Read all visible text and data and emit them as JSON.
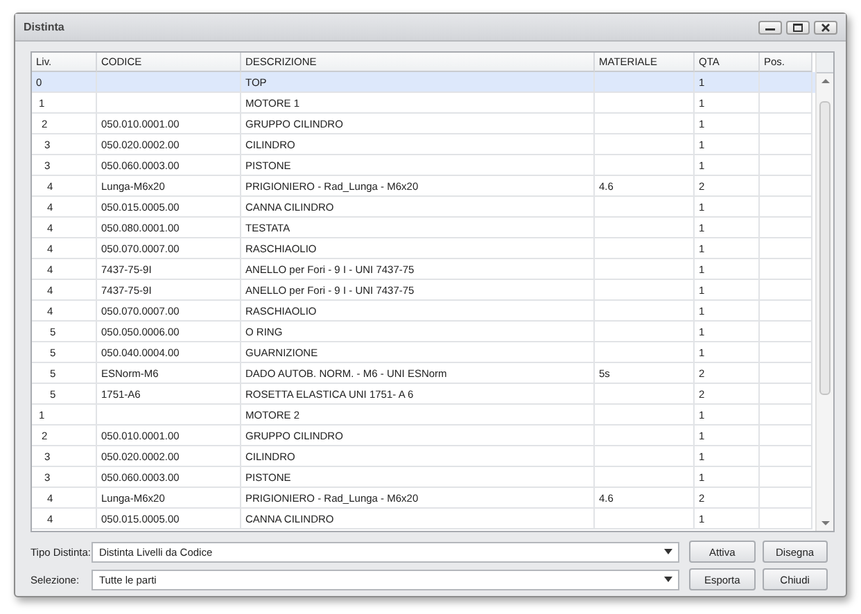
{
  "window": {
    "title": "Distinta"
  },
  "table": {
    "columns": [
      "Liv.",
      "CODICE",
      "DESCRIZIONE",
      "MATERIALE",
      "QTA",
      "Pos."
    ],
    "rows": [
      {
        "cells": [
          "0",
          "",
          "TOP",
          "",
          "1",
          ""
        ],
        "selected": true
      },
      {
        "cells": [
          "1",
          "",
          "MOTORE 1",
          "",
          "1",
          ""
        ],
        "selected": false
      },
      {
        "cells": [
          "2",
          "050.010.0001.00",
          "GRUPPO CILINDRO",
          "",
          "1",
          ""
        ],
        "selected": false
      },
      {
        "cells": [
          "3",
          "050.020.0002.00",
          "CILINDRO",
          "",
          "1",
          ""
        ],
        "selected": false
      },
      {
        "cells": [
          "3",
          "050.060.0003.00",
          "PISTONE",
          "",
          "1",
          ""
        ],
        "selected": false
      },
      {
        "cells": [
          "4",
          "Lunga-M6x20",
          "PRIGIONIERO - Rad_Lunga - M6x20",
          "4.6",
          "2",
          ""
        ],
        "selected": false
      },
      {
        "cells": [
          "4",
          "050.015.0005.00",
          "CANNA CILINDRO",
          "",
          "1",
          ""
        ],
        "selected": false
      },
      {
        "cells": [
          "4",
          "050.080.0001.00",
          "TESTATA",
          "",
          "1",
          ""
        ],
        "selected": false
      },
      {
        "cells": [
          "4",
          "050.070.0007.00",
          "RASCHIAOLIO",
          "",
          "1",
          ""
        ],
        "selected": false
      },
      {
        "cells": [
          "4",
          "7437-75-9I",
          "ANELLO per Fori - 9 I - UNI 7437-75",
          "",
          "1",
          ""
        ],
        "selected": false
      },
      {
        "cells": [
          "4",
          "7437-75-9I",
          "ANELLO per Fori - 9 I - UNI 7437-75",
          "",
          "1",
          ""
        ],
        "selected": false
      },
      {
        "cells": [
          "4",
          "050.070.0007.00",
          "RASCHIAOLIO",
          "",
          "1",
          ""
        ],
        "selected": false
      },
      {
        "cells": [
          "5",
          "050.050.0006.00",
          "O RING",
          "",
          "1",
          ""
        ],
        "selected": false
      },
      {
        "cells": [
          "5",
          "050.040.0004.00",
          "GUARNIZIONE",
          "",
          "1",
          ""
        ],
        "selected": false
      },
      {
        "cells": [
          "5",
          "ESNorm-M6",
          "DADO AUTOB. NORM. - M6 - UNI ESNorm",
          "5s",
          "2",
          ""
        ],
        "selected": false
      },
      {
        "cells": [
          "5",
          "1751-A6",
          "ROSETTA ELASTICA UNI 1751- A 6",
          "",
          "2",
          ""
        ],
        "selected": false
      },
      {
        "cells": [
          "1",
          "",
          "MOTORE 2",
          "",
          "1",
          ""
        ],
        "selected": false
      },
      {
        "cells": [
          "2",
          "050.010.0001.00",
          "GRUPPO CILINDRO",
          "",
          "1",
          ""
        ],
        "selected": false
      },
      {
        "cells": [
          "3",
          "050.020.0002.00",
          "CILINDRO",
          "",
          "1",
          ""
        ],
        "selected": false
      },
      {
        "cells": [
          "3",
          "050.060.0003.00",
          "PISTONE",
          "",
          "1",
          ""
        ],
        "selected": false
      },
      {
        "cells": [
          "4",
          "Lunga-M6x20",
          "PRIGIONIERO - Rad_Lunga - M6x20",
          "4.6",
          "2",
          ""
        ],
        "selected": false
      },
      {
        "cells": [
          "4",
          "050.015.0005.00",
          "CANNA CILINDRO",
          "",
          "1",
          ""
        ],
        "selected": false
      }
    ]
  },
  "controls": [
    {
      "label": "Tipo Distinta:",
      "value": "Distinta Livelli da Codice",
      "buttons": [
        "Attiva",
        "Disegna"
      ]
    },
    {
      "label": "Selezione:",
      "value": "Tutte le parti",
      "buttons": [
        "Esporta",
        "Chiudi"
      ]
    }
  ]
}
